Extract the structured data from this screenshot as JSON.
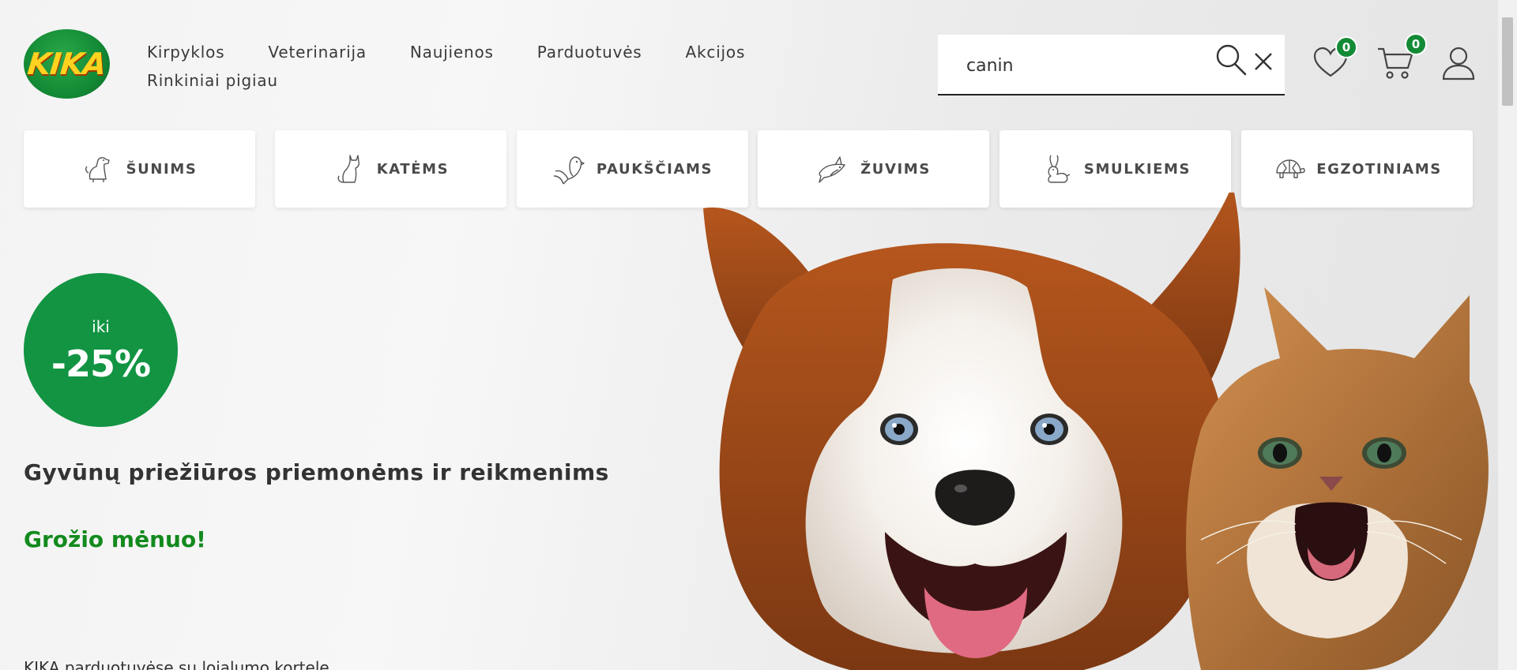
{
  "logo": {
    "text": "KIKA"
  },
  "nav": {
    "row1": [
      "Kirpyklos",
      "Veterinarija",
      "Naujienos",
      "Parduotuvės",
      "Akcijos"
    ],
    "row2": [
      "Rinkiniai pigiau"
    ]
  },
  "search": {
    "value": "canin",
    "placeholder": ""
  },
  "wishlist": {
    "count": "0"
  },
  "cart": {
    "count": "0"
  },
  "categories": [
    {
      "label": "ŠUNIMS",
      "icon": "dog-icon"
    },
    {
      "label": "KATĖMS",
      "icon": "cat-icon"
    },
    {
      "label": "PAUKŠČIAMS",
      "icon": "bird-icon"
    },
    {
      "label": "ŽUVIMS",
      "icon": "fish-icon"
    },
    {
      "label": "SMULKIEMS",
      "icon": "rabbit-icon"
    },
    {
      "label": "EGZOTINIAMS",
      "icon": "turtle-icon"
    }
  ],
  "hero": {
    "discount_prefix": "iki",
    "discount_amount": "-25%",
    "title": "Gyvūnų priežiūros priemonėms ir reikmenims",
    "subtitle": "Grožio mėnuo!",
    "note": "KIKA parduotuvėse su lojalumo kortele"
  },
  "colors": {
    "brand_green": "#129443",
    "subtitle_green": "#138a1e",
    "logo_yellow": "#ffd21f"
  }
}
